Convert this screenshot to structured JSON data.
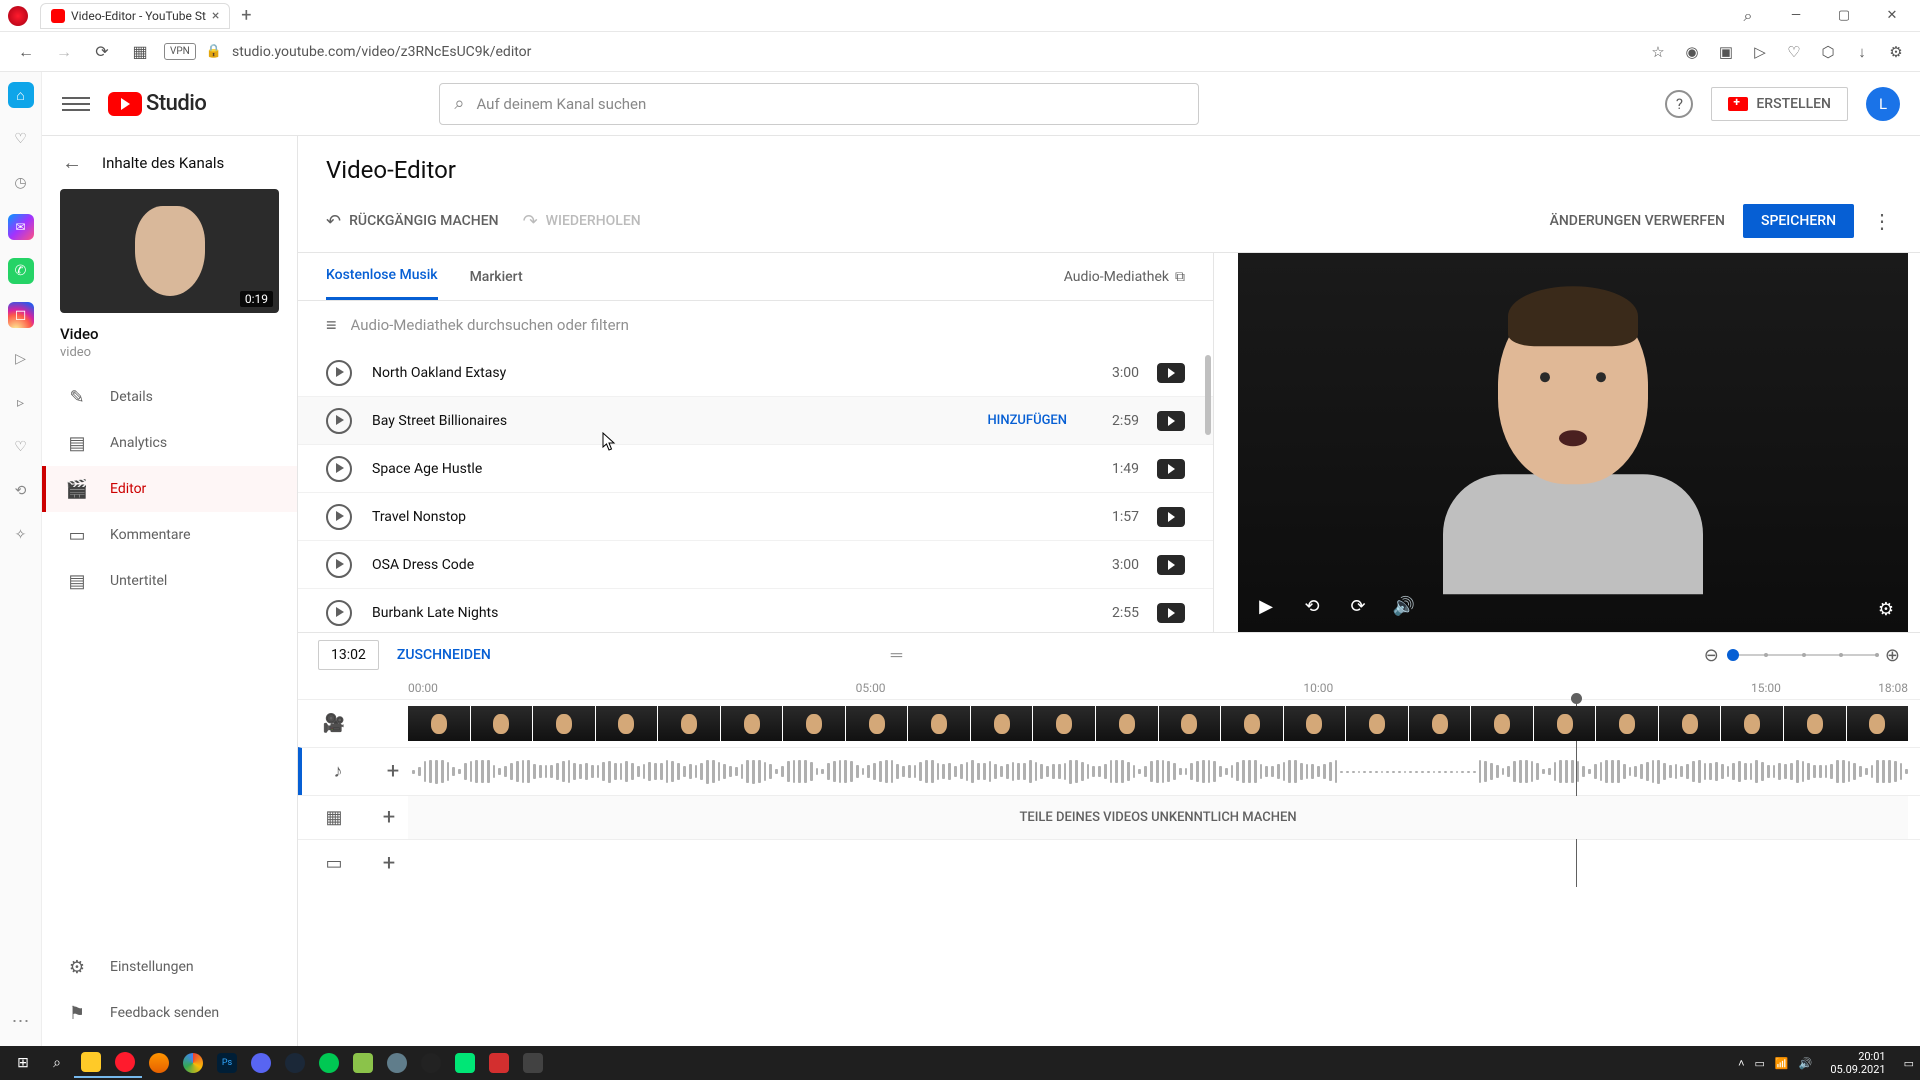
{
  "browser": {
    "tab_title": "Video-Editor - YouTube St",
    "url": "studio.youtube.com/video/z3RNcEsUC9k/editor",
    "vpn": "VPN"
  },
  "header": {
    "logo_text": "Studio",
    "search_placeholder": "Auf deinem Kanal suchen",
    "create_label": "ERSTELLEN",
    "avatar_letter": "L"
  },
  "leftnav": {
    "back_label": "Inhalte des Kanals",
    "thumb_duration": "0:19",
    "video_title": "Video",
    "video_sub": "video",
    "items": [
      {
        "icon": "✎",
        "label": "Details"
      },
      {
        "icon": "▤",
        "label": "Analytics"
      },
      {
        "icon": "🎬",
        "label": "Editor"
      },
      {
        "icon": "▭",
        "label": "Kommentare"
      },
      {
        "icon": "▤",
        "label": "Untertitel"
      }
    ],
    "settings_label": "Einstellungen",
    "feedback_label": "Feedback senden"
  },
  "editor": {
    "title": "Video-Editor",
    "undo_label": "RÜCKGÄNGIG MACHEN",
    "redo_label": "WIEDERHOLEN",
    "discard_label": "ÄNDERUNGEN VERWERFEN",
    "save_label": "SPEICHERN"
  },
  "library": {
    "tab_free": "Kostenlose Musik",
    "tab_starred": "Markiert",
    "link_label": "Audio-Mediathek",
    "filter_placeholder": "Audio-Mediathek durchsuchen oder filtern",
    "add_label": "HINZUFÜGEN",
    "tracks": [
      {
        "name": "North Oakland Extasy",
        "dur": "3:00"
      },
      {
        "name": "Bay Street Billionaires",
        "dur": "2:59"
      },
      {
        "name": "Space Age Hustle",
        "dur": "1:49"
      },
      {
        "name": "Travel Nonstop",
        "dur": "1:57"
      },
      {
        "name": "OSA Dress Code",
        "dur": "3:00"
      },
      {
        "name": "Burbank Late Nights",
        "dur": "2:55"
      }
    ]
  },
  "timeline": {
    "timecode": "13:02",
    "trim_label": "ZUSCHNEIDEN",
    "ruler": [
      "00:00",
      "05:00",
      "10:00",
      "15:00",
      "18:08"
    ],
    "blur_label": "TEILE DEINES VIDEOS UNKENNTLICH MACHEN"
  },
  "taskbar": {
    "time": "20:01",
    "date": "05.09.2021"
  }
}
